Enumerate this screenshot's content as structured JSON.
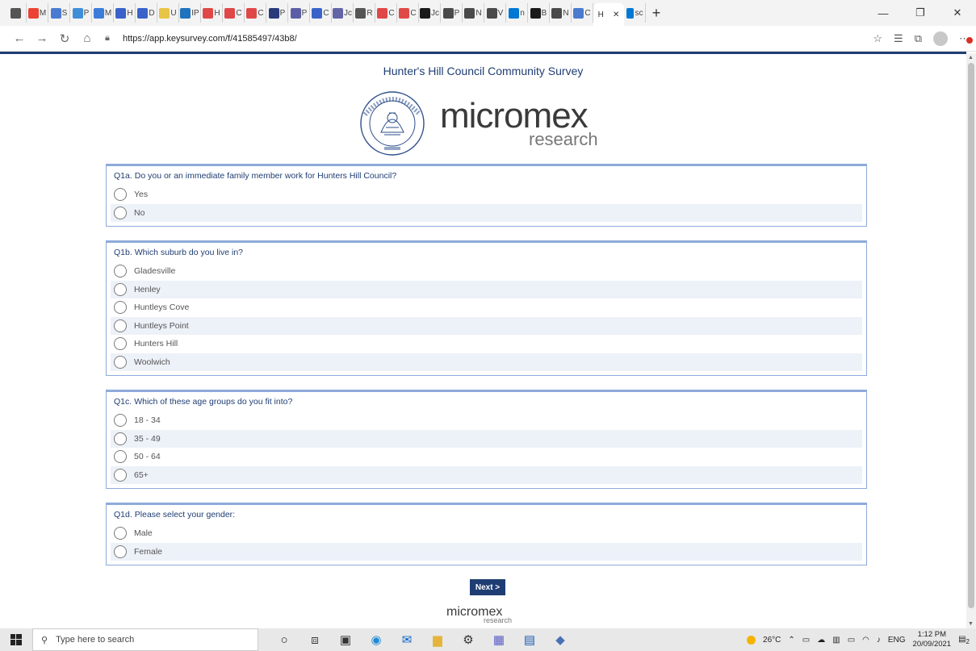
{
  "browser": {
    "active_tab_label": "H",
    "url": "https://app.keysurvey.com/f/41585497/43b8/",
    "tabs": [
      {
        "label": "",
        "color": "#555555"
      },
      {
        "label": "M",
        "color": "#ea4335"
      },
      {
        "label": "S",
        "color": "#4a7bd0"
      },
      {
        "label": "P",
        "color": "#3f8ed8"
      },
      {
        "label": "M",
        "color": "#3c7bd9"
      },
      {
        "label": "H",
        "color": "#3a63c9"
      },
      {
        "label": "D",
        "color": "#3a63c9"
      },
      {
        "label": "U",
        "color": "#e8c547"
      },
      {
        "label": "IP",
        "color": "#1e73be"
      },
      {
        "label": "H",
        "color": "#e04848"
      },
      {
        "label": "C",
        "color": "#e04848"
      },
      {
        "label": "C",
        "color": "#e04848"
      },
      {
        "label": "P",
        "color": "#283a7a"
      },
      {
        "label": "P",
        "color": "#5b5ea6"
      },
      {
        "label": "C",
        "color": "#3a63c9"
      },
      {
        "label": "Jc",
        "color": "#6264a7"
      },
      {
        "label": "R",
        "color": "#555555"
      },
      {
        "label": "C",
        "color": "#e04848"
      },
      {
        "label": "C",
        "color": "#e04848"
      },
      {
        "label": "Jc",
        "color": "#1a1a1a"
      },
      {
        "label": "P",
        "color": "#4a4a4a"
      },
      {
        "label": "N",
        "color": "#4a4a4a"
      },
      {
        "label": "V",
        "color": "#4a4a4a"
      },
      {
        "label": "n",
        "color": "#0078d4"
      },
      {
        "label": "B",
        "color": "#1a1a1a"
      },
      {
        "label": "N",
        "color": "#4a4a4a"
      },
      {
        "label": "C",
        "color": "#4a7bd0"
      }
    ],
    "extra_tab_label": "sc"
  },
  "survey": {
    "title": "Hunter's Hill Council Community Survey",
    "brand_main": "micromex",
    "brand_sub": "research",
    "seal_top": "MUNICIPALITY OF HUNTERS HILL",
    "seal_year": "1861",
    "questions": [
      {
        "num": "Q1a.",
        "text": "Do you or an immediate family member work for Hunters Hill Council?",
        "options": [
          "Yes",
          "No"
        ]
      },
      {
        "num": "Q1b.",
        "text": "Which suburb do you live in?",
        "options": [
          "Gladesville",
          "Henley",
          "Huntleys Cove",
          "Huntleys Point",
          "Hunters Hill",
          "Woolwich"
        ]
      },
      {
        "num": "Q1c.",
        "text": "Which of these age groups do you fit into?",
        "options": [
          "18 - 34",
          "35 - 49",
          "50 - 64",
          "65+"
        ]
      },
      {
        "num": "Q1d.",
        "text": "Please select your gender:",
        "options": [
          "Male",
          "Female"
        ]
      }
    ],
    "next_label": "Next >"
  },
  "taskbar": {
    "search_placeholder": "Type here to search",
    "weather": "26°C",
    "lang": "ENG",
    "time": "1:12 PM",
    "date": "20/09/2021",
    "notif_count": "2"
  },
  "colors": {
    "accent": "#1f3d73",
    "border": "#8eaadb",
    "alt_row": "#edf1f8"
  }
}
